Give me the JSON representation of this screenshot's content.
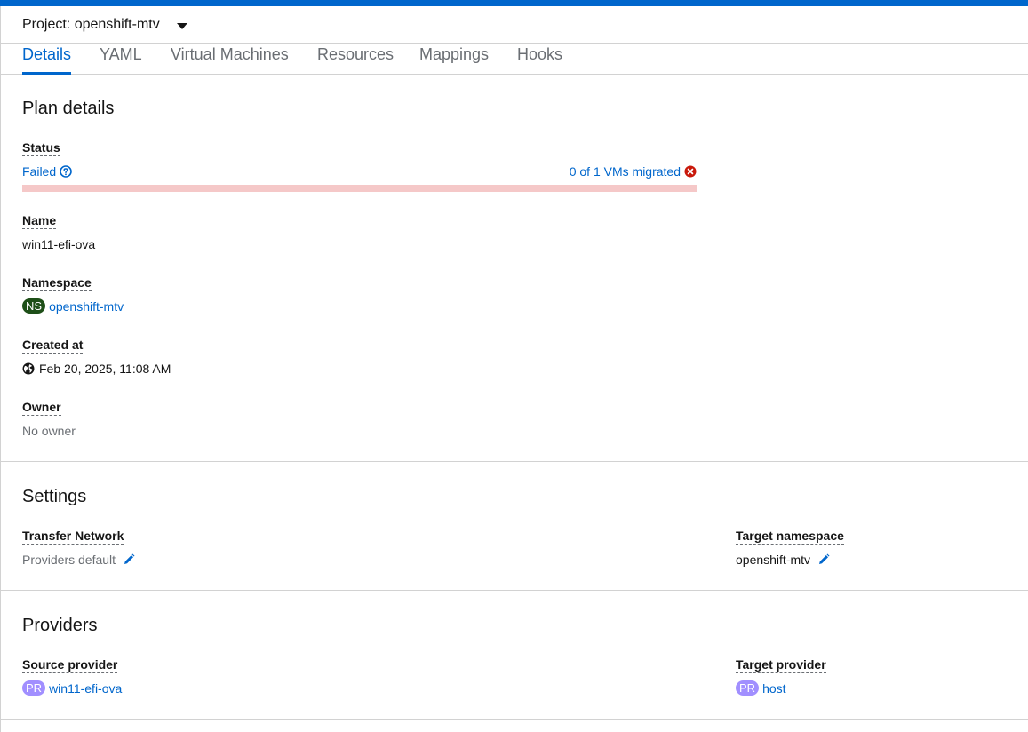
{
  "project_bar": {
    "project_label": "Project: openshift-mtv"
  },
  "tabs": [
    {
      "label": "Details",
      "active": true
    },
    {
      "label": "YAML",
      "active": false
    },
    {
      "label": "Virtual Machines",
      "active": false
    },
    {
      "label": "Resources",
      "active": false
    },
    {
      "label": "Mappings",
      "active": false
    },
    {
      "label": "Hooks",
      "active": false
    }
  ],
  "plan_details": {
    "heading": "Plan details",
    "status": {
      "label": "Status",
      "value": "Failed",
      "migration_summary": "0 of 1 VMs migrated",
      "progress_fraction": 0,
      "status_color": "#c9190b"
    },
    "name": {
      "label": "Name",
      "value": "win11-efi-ova"
    },
    "namespace": {
      "label": "Namespace",
      "badge": "NS",
      "value": "openshift-mtv"
    },
    "created_at": {
      "label": "Created at",
      "value": "Feb 20, 2025, 11:08 AM"
    },
    "owner": {
      "label": "Owner",
      "value": "No owner"
    }
  },
  "settings": {
    "heading": "Settings",
    "transfer_network": {
      "label": "Transfer Network",
      "value": "Providers default"
    },
    "target_namespace": {
      "label": "Target namespace",
      "value": "openshift-mtv"
    }
  },
  "providers": {
    "heading": "Providers",
    "source_provider": {
      "label": "Source provider",
      "badge": "PR",
      "value": "win11-efi-ova"
    },
    "target_provider": {
      "label": "Target provider",
      "badge": "PR",
      "value": "host"
    }
  },
  "colors": {
    "accent": "#0066cc",
    "danger": "#c9190b",
    "namespace_badge": "#1e4f18",
    "provider_badge": "#a18fff"
  },
  "icons": {
    "project_caret": "caret-down-icon",
    "status_help": "question-circle-icon",
    "migration_error": "times-circle-icon",
    "created_at": "globe-icon",
    "edit": "pencil-icon"
  }
}
